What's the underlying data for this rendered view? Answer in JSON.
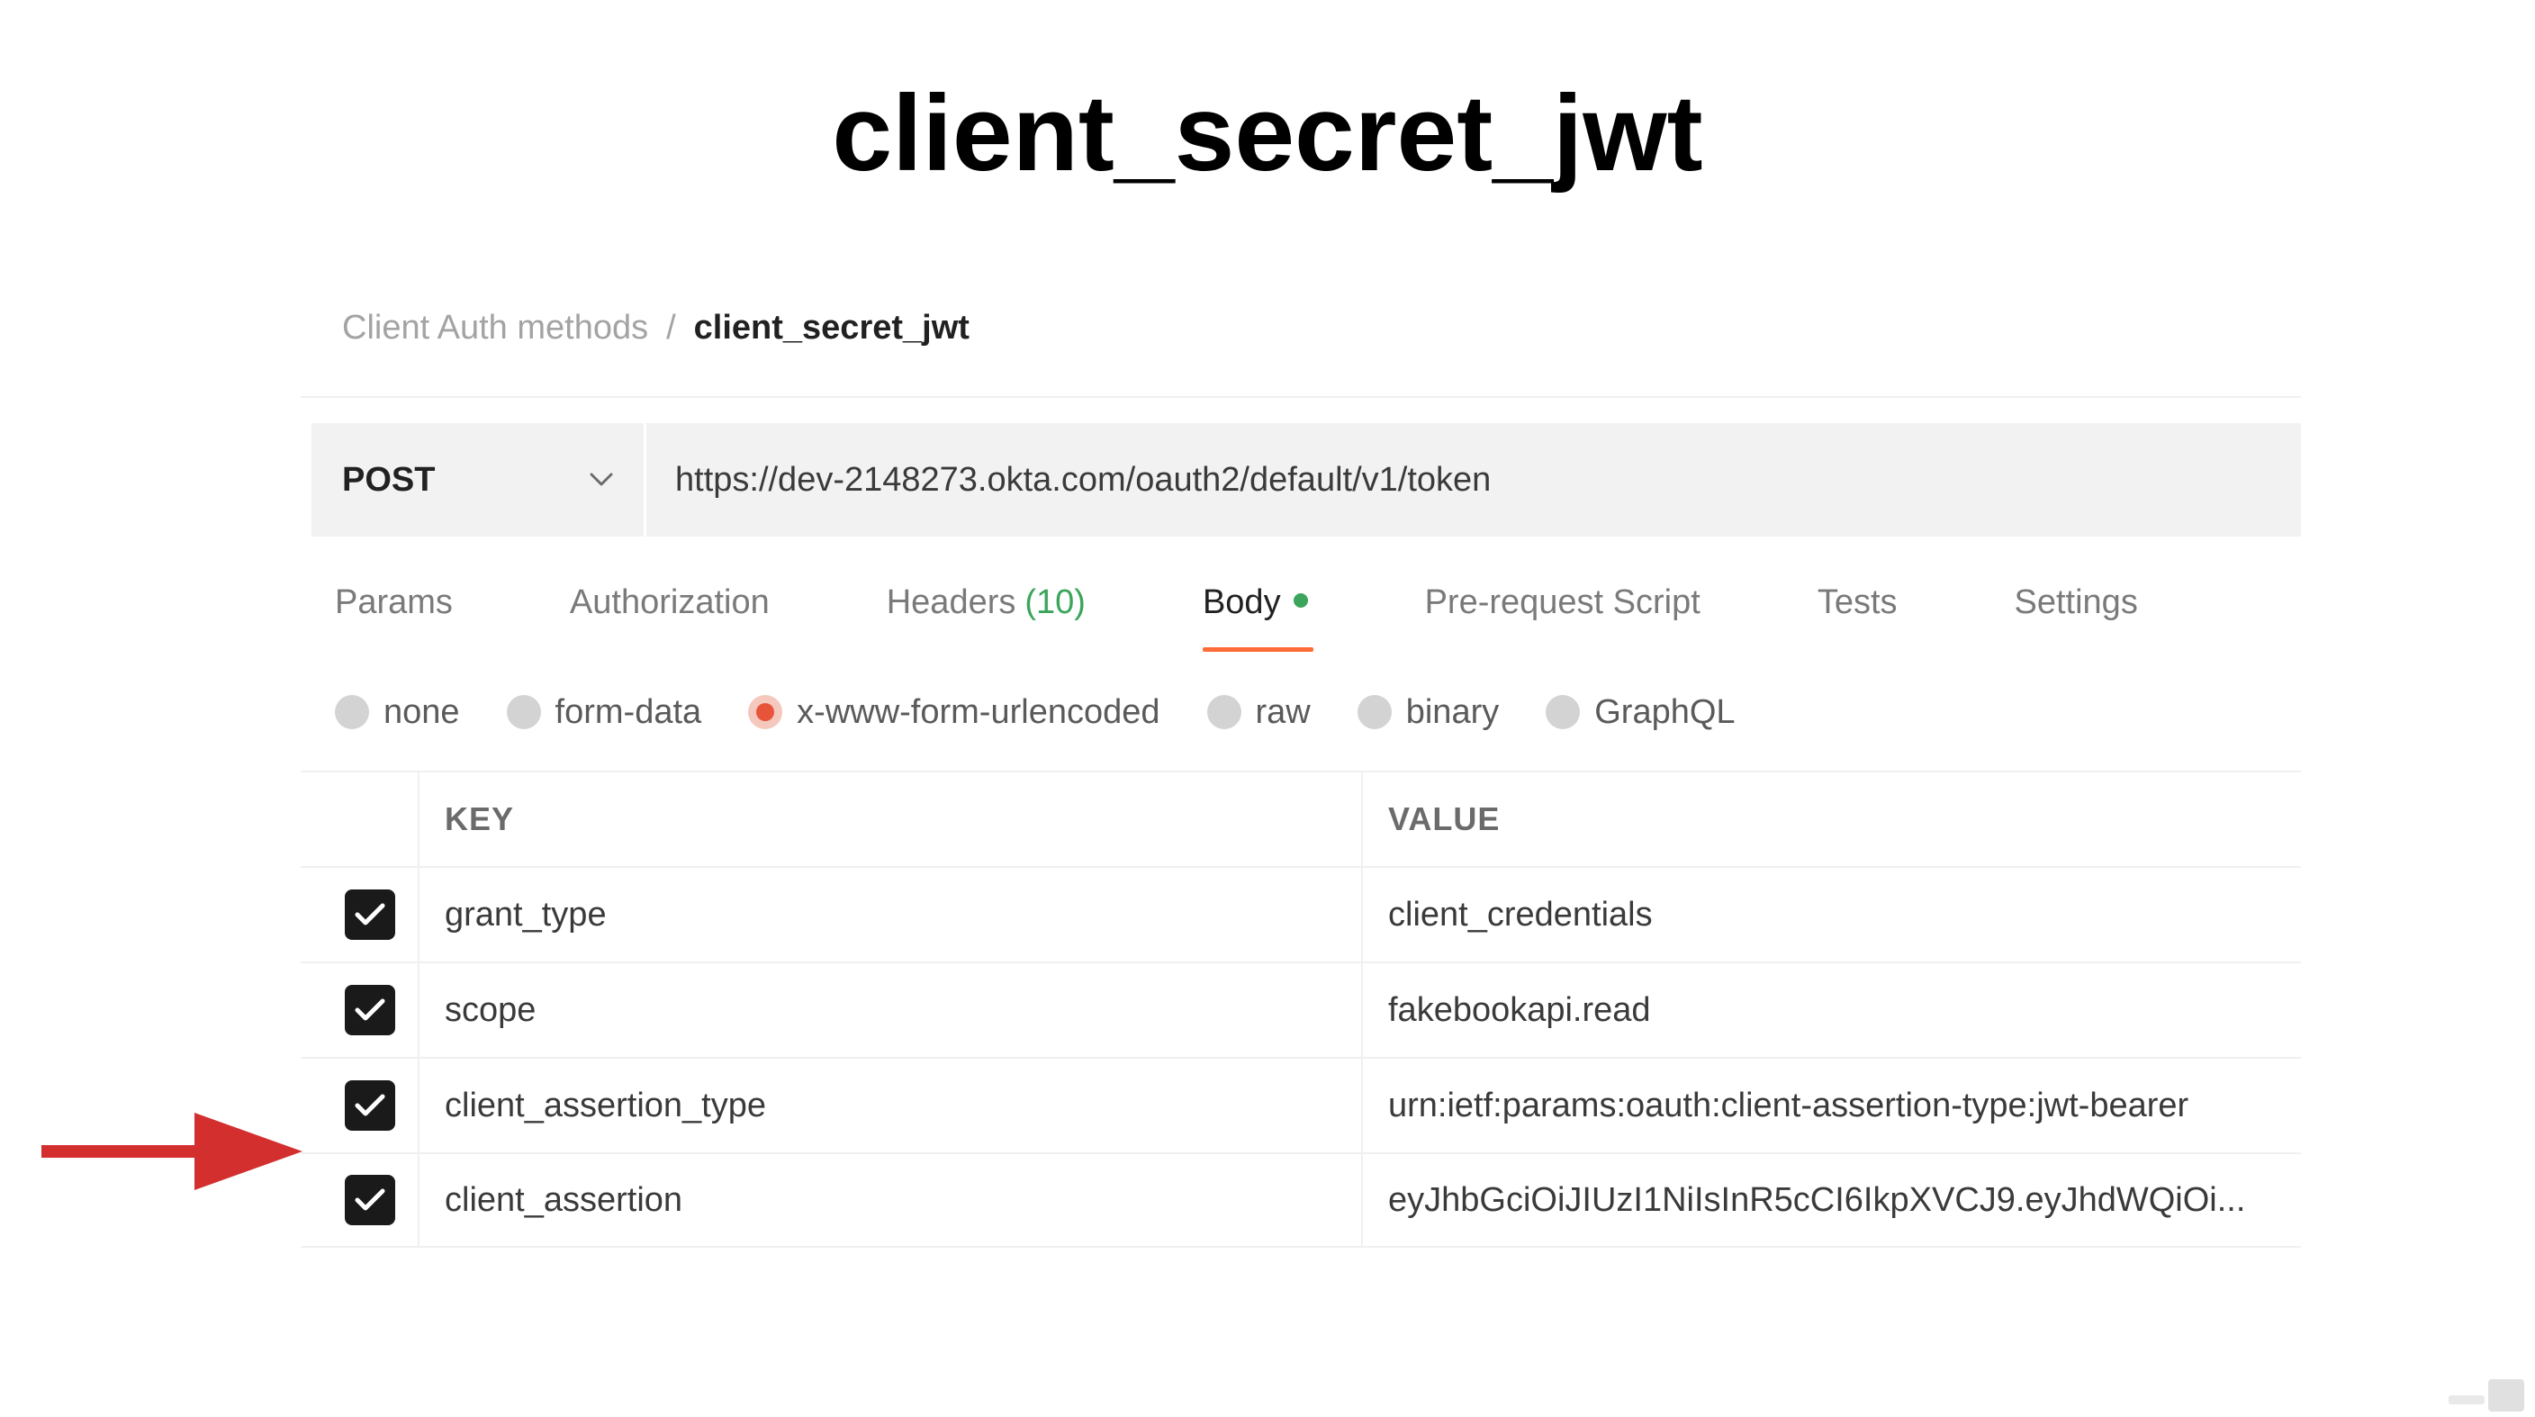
{
  "slide": {
    "title": "client_secret_jwt"
  },
  "breadcrumb": {
    "parent": "Client Auth methods",
    "separator": "/",
    "current": "client_secret_jwt"
  },
  "request": {
    "method": "POST",
    "url": "https://dev-2148273.okta.com/oauth2/default/v1/token"
  },
  "tabs": [
    {
      "label": "Params"
    },
    {
      "label": "Authorization"
    },
    {
      "label": "Headers",
      "count": "(10)"
    },
    {
      "label": "Body",
      "active": true
    },
    {
      "label": "Pre-request Script"
    },
    {
      "label": "Tests"
    },
    {
      "label": "Settings"
    }
  ],
  "body_types": [
    {
      "label": "none"
    },
    {
      "label": "form-data"
    },
    {
      "label": "x-www-form-urlencoded",
      "selected": true
    },
    {
      "label": "raw"
    },
    {
      "label": "binary"
    },
    {
      "label": "GraphQL"
    }
  ],
  "table": {
    "headers": {
      "key": "KEY",
      "value": "VALUE"
    },
    "rows": [
      {
        "key": "grant_type",
        "value": "client_credentials",
        "checked": true
      },
      {
        "key": "scope",
        "value": "fakebookapi.read",
        "checked": true
      },
      {
        "key": "client_assertion_type",
        "value": "urn:ietf:params:oauth:client-assertion-type:jwt-bearer",
        "checked": true
      },
      {
        "key": "client_assertion",
        "value": "eyJhbGciOiJIUzI1NiIsInR5cCI6IkpXVCJ9.eyJhdWQiOi...",
        "checked": true
      }
    ]
  },
  "colors": {
    "accent": "#ff6c37",
    "success": "#3aa55b",
    "arrow": "#d32f2f"
  },
  "icons": {
    "chevron": "chevron-down-icon",
    "checkbox": "checkmark-icon",
    "arrow": "arrow-right-icon"
  }
}
